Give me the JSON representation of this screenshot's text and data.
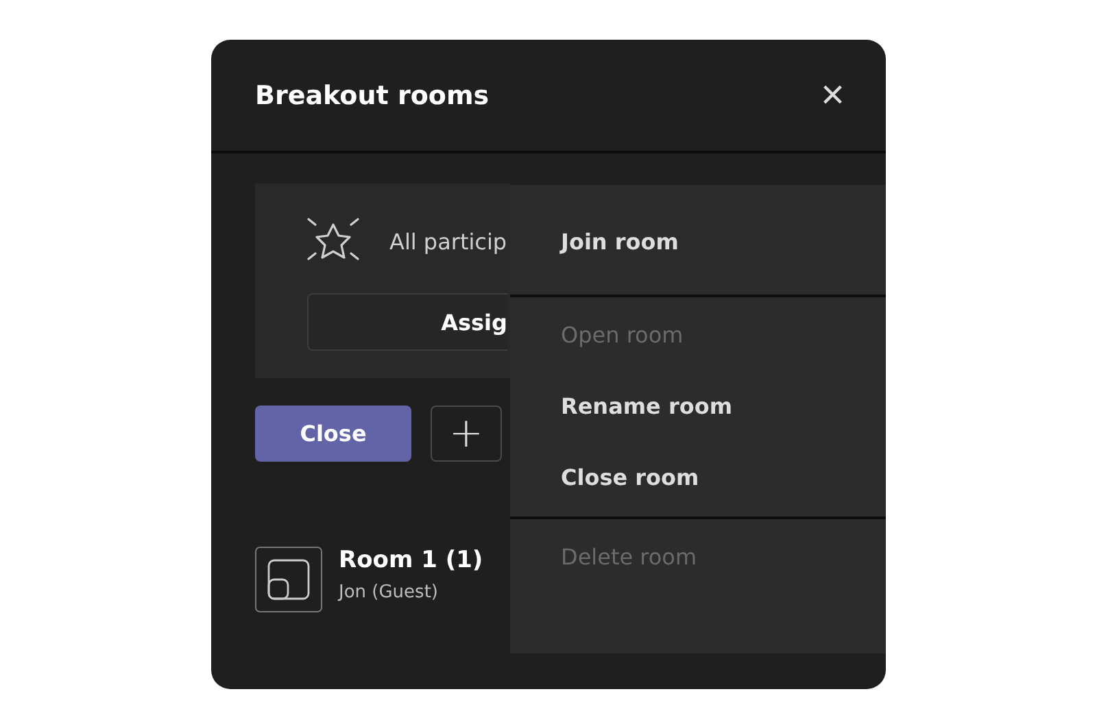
{
  "dialog": {
    "title": "Breakout rooms",
    "close_icon": "×"
  },
  "banner": {
    "text": "All particip",
    "button": "Assig"
  },
  "actions": {
    "close_button": "Close",
    "add_button": "+"
  },
  "rooms": [
    {
      "name": "Room 1 (1)",
      "members": "Jon (Guest)"
    }
  ],
  "context_menu": {
    "sections": [
      {
        "items": [
          {
            "label": "Join room",
            "disabled": false
          }
        ]
      },
      {
        "items": [
          {
            "label": "Open room",
            "disabled": true
          },
          {
            "label": "Rename room",
            "disabled": false
          },
          {
            "label": "Close room",
            "disabled": false
          }
        ]
      },
      {
        "items": [
          {
            "label": "Delete room",
            "disabled": true
          }
        ]
      }
    ]
  }
}
